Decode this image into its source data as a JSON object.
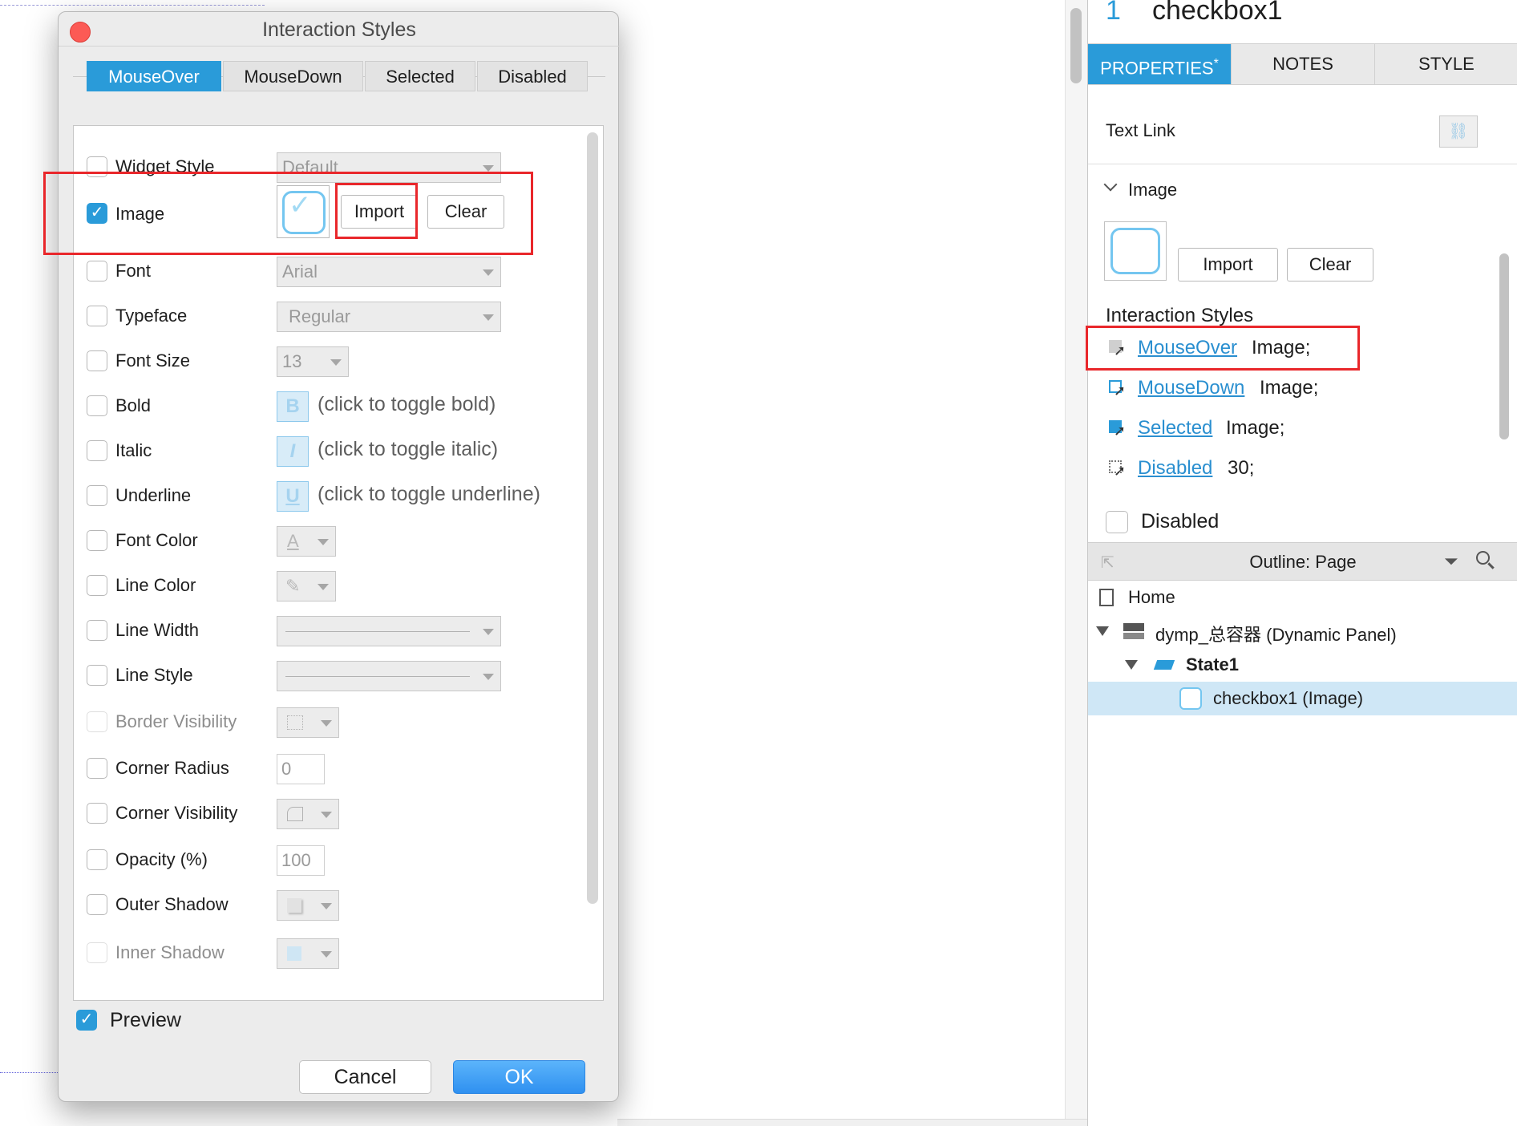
{
  "dialog": {
    "title": "Interaction Styles",
    "tabs": [
      "MouseOver",
      "MouseDown",
      "Selected",
      "Disabled"
    ],
    "active_tab": "MouseOver",
    "rows": {
      "widget_style": {
        "label": "Widget Style",
        "value": "Default"
      },
      "image": {
        "label": "Image",
        "import_label": "Import",
        "clear_label": "Clear"
      },
      "font": {
        "label": "Font",
        "value": "Arial"
      },
      "typeface": {
        "label": "Typeface",
        "value": "Regular"
      },
      "font_size": {
        "label": "Font Size",
        "value": "13"
      },
      "bold": {
        "label": "Bold",
        "glyph": "B",
        "hint": "(click to toggle bold)"
      },
      "italic": {
        "label": "Italic",
        "glyph": "I",
        "hint": "(click to toggle italic)"
      },
      "underline": {
        "label": "Underline",
        "glyph": "U",
        "hint": "(click to toggle underline)"
      },
      "font_color": {
        "label": "Font Color",
        "glyph": "A"
      },
      "line_color": {
        "label": "Line Color",
        "glyph": "✎"
      },
      "line_width": {
        "label": "Line Width"
      },
      "line_style": {
        "label": "Line Style"
      },
      "border_visibility": {
        "label": "Border Visibility"
      },
      "corner_radius": {
        "label": "Corner Radius",
        "value": "0"
      },
      "corner_visibility": {
        "label": "Corner Visibility"
      },
      "opacity": {
        "label": "Opacity (%)",
        "value": "100"
      },
      "outer_shadow": {
        "label": "Outer Shadow"
      },
      "inner_shadow": {
        "label": "Inner Shadow"
      }
    },
    "preview_label": "Preview",
    "cancel_label": "Cancel",
    "ok_label": "OK"
  },
  "widget": {
    "number": "1",
    "name": "checkbox1"
  },
  "right_tabs": [
    "PROPERTIES",
    "NOTES",
    "STYLE"
  ],
  "right_tab_marker": "*",
  "properties": {
    "text_link_label": "Text Link",
    "image_section_label": "Image",
    "import_label": "Import",
    "clear_label": "Clear",
    "interaction_styles_title": "Interaction Styles",
    "styles": [
      {
        "name": "MouseOver",
        "value": "Image;",
        "icon": "mouseover-style-icon"
      },
      {
        "name": "MouseDown",
        "value": "Image;",
        "icon": "mousedown-style-icon"
      },
      {
        "name": "Selected",
        "value": "Image;",
        "icon": "selected-style-icon"
      },
      {
        "name": "Disabled",
        "value": "30;",
        "icon": "disabled-style-icon"
      }
    ],
    "disabled_label": "Disabled"
  },
  "outline": {
    "title": "Outline: Page",
    "items": [
      {
        "label": "Home",
        "icon": "page-icon"
      },
      {
        "label": "dymp_总容器 (Dynamic Panel)",
        "icon": "dynamic-panel-icon"
      },
      {
        "label": "State1",
        "icon": "state-icon"
      },
      {
        "label": "checkbox1 (Image)",
        "icon": "checkbox-image-icon",
        "selected": true
      }
    ]
  },
  "colors": {
    "accent": "#2a9bd9",
    "annotation_red": "#e9272b",
    "ok_blue": "#2f90f0",
    "link_blue": "#2a8fd0"
  }
}
